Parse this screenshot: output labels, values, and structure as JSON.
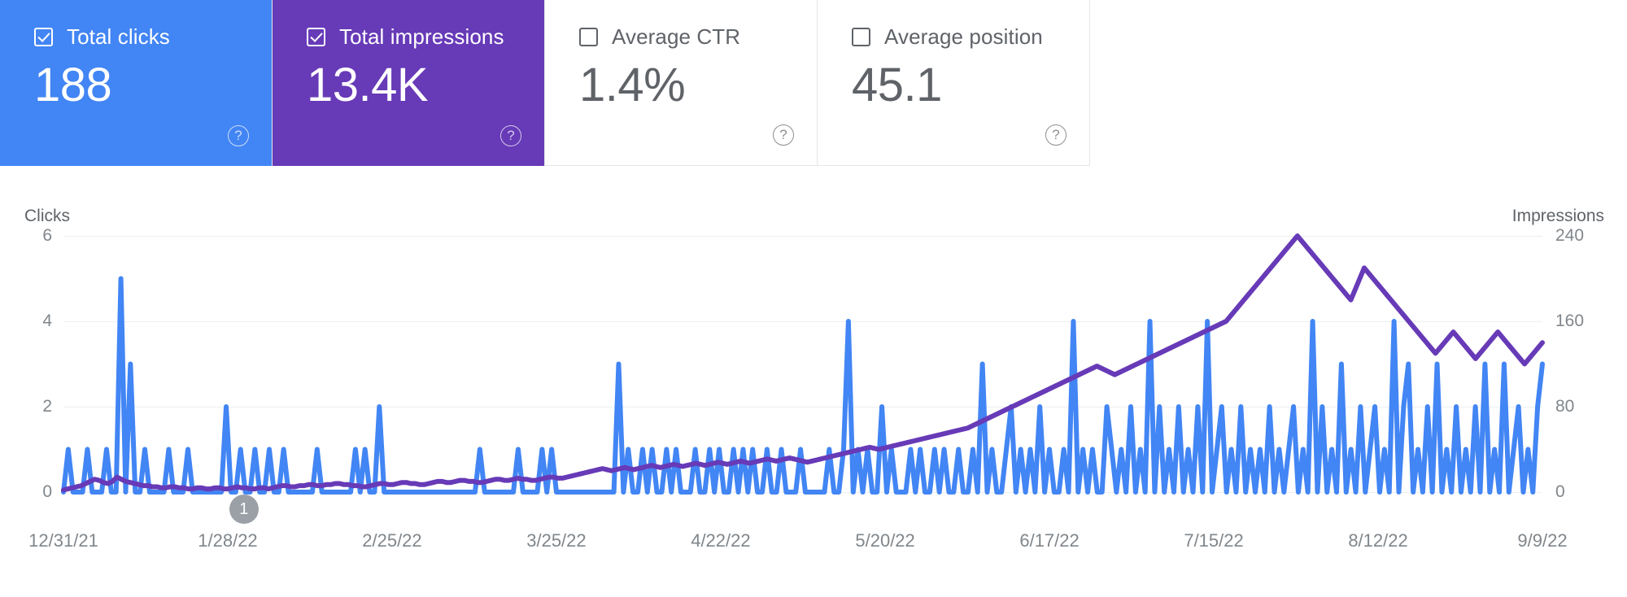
{
  "metric_cards": [
    {
      "id": "total-clicks",
      "label": "Total clicks",
      "value": "188",
      "checked": true,
      "selected": true,
      "bg": "#4285F4",
      "fg": "#ffffff",
      "help": "?"
    },
    {
      "id": "total-impressions",
      "label": "Total impressions",
      "value": "13.4K",
      "checked": true,
      "selected": true,
      "bg": "#673AB7",
      "fg": "#ffffff",
      "help": "?"
    },
    {
      "id": "average-ctr",
      "label": "Average CTR",
      "value": "1.4%",
      "checked": false,
      "selected": false,
      "bg": "#ffffff",
      "fg": "#5f6368",
      "help": "?"
    },
    {
      "id": "average-position",
      "label": "Average position",
      "value": "45.1",
      "checked": false,
      "selected": false,
      "bg": "#ffffff",
      "fg": "#5f6368",
      "help": "?"
    }
  ],
  "annotation": {
    "label": "1",
    "x_fraction": 0.122
  },
  "chart_data": {
    "type": "line",
    "title": "",
    "left_axis": {
      "label": "Clicks",
      "ticks": [
        0,
        2,
        4,
        6
      ],
      "min": 0,
      "max": 6,
      "color": "#4285F4"
    },
    "right_axis": {
      "label": "Impressions",
      "ticks": [
        0,
        80,
        160,
        240
      ],
      "min": 0,
      "max": 240,
      "color": "#673AB7"
    },
    "grid": true,
    "legend": "metric-cards",
    "xlabel": "",
    "x_tick_labels": [
      "12/31/21",
      "1/28/22",
      "2/25/22",
      "3/25/22",
      "4/22/22",
      "5/20/22",
      "6/17/22",
      "7/15/22",
      "8/12/22",
      "9/9/22"
    ],
    "x_tick_fractions": [
      0.0,
      0.1111,
      0.2222,
      0.3333,
      0.4444,
      0.5556,
      0.6667,
      0.7778,
      0.8889,
      1.0
    ],
    "x_start": "12/31/21",
    "x_end": "9/23/22",
    "series": [
      {
        "name": "Clicks",
        "axis": "left",
        "color": "#4285F4",
        "values": [
          0,
          1,
          0,
          0,
          0,
          1,
          0,
          0,
          0,
          1,
          0,
          0,
          5,
          0,
          3,
          0,
          0,
          1,
          0,
          0,
          0,
          0,
          1,
          0,
          0,
          0,
          1,
          0,
          0,
          0,
          0,
          0,
          0,
          0,
          2,
          0,
          0,
          1,
          0,
          0,
          1,
          0,
          0,
          1,
          0,
          0,
          1,
          0,
          0,
          0,
          0,
          0,
          0,
          1,
          0,
          0,
          0,
          0,
          0,
          0,
          0,
          1,
          0,
          1,
          0,
          0,
          2,
          0,
          0,
          0,
          0,
          0,
          0,
          0,
          0,
          0,
          0,
          0,
          0,
          0,
          0,
          0,
          0,
          0,
          0,
          0,
          0,
          1,
          0,
          0,
          0,
          0,
          0,
          0,
          0,
          1,
          0,
          0,
          0,
          0,
          1,
          0,
          1,
          0,
          0,
          0,
          0,
          0,
          0,
          0,
          0,
          0,
          0,
          0,
          0,
          0,
          3,
          0,
          1,
          0,
          0,
          1,
          0,
          1,
          0,
          0,
          1,
          0,
          1,
          0,
          0,
          0,
          1,
          0,
          0,
          1,
          0,
          1,
          0,
          0,
          1,
          0,
          1,
          0,
          1,
          0,
          0,
          1,
          0,
          0,
          1,
          0,
          0,
          0,
          1,
          0,
          0,
          0,
          0,
          0,
          1,
          0,
          0,
          1,
          4,
          0,
          1,
          0,
          1,
          0,
          0,
          2,
          0,
          1,
          0,
          0,
          0,
          1,
          0,
          1,
          0,
          0,
          1,
          0,
          1,
          0,
          0,
          1,
          0,
          0,
          1,
          0,
          3,
          0,
          1,
          0,
          0,
          1,
          2,
          0,
          1,
          0,
          1,
          0,
          2,
          0,
          1,
          0,
          0,
          1,
          0,
          4,
          0,
          1,
          0,
          1,
          0,
          0,
          2,
          1,
          0,
          1,
          0,
          2,
          0,
          1,
          0,
          4,
          0,
          2,
          0,
          1,
          0,
          2,
          0,
          1,
          0,
          2,
          0,
          4,
          0,
          1,
          2,
          0,
          1,
          0,
          2,
          0,
          1,
          0,
          1,
          0,
          2,
          0,
          1,
          0,
          1,
          2,
          0,
          1,
          0,
          4,
          0,
          2,
          0,
          1,
          0,
          3,
          0,
          1,
          0,
          2,
          0,
          1,
          2,
          0,
          1,
          0,
          4,
          0,
          2,
          3,
          0,
          1,
          0,
          2,
          0,
          3,
          0,
          1,
          0,
          2,
          0,
          1,
          0,
          2,
          0,
          3,
          0,
          1,
          0,
          3,
          0,
          1,
          2,
          0,
          1,
          0,
          2,
          3
        ]
      },
      {
        "name": "Impressions",
        "axis": "right",
        "color": "#673AB7",
        "values": [
          2,
          3,
          4,
          5,
          6,
          8,
          10,
          12,
          11,
          9,
          8,
          10,
          14,
          12,
          10,
          9,
          8,
          7,
          6,
          6,
          5,
          5,
          4,
          4,
          5,
          5,
          4,
          4,
          3,
          3,
          4,
          4,
          3,
          3,
          4,
          4,
          3,
          3,
          4,
          5,
          4,
          4,
          3,
          3,
          4,
          4,
          3,
          4,
          5,
          6,
          6,
          5,
          5,
          6,
          6,
          7,
          7,
          6,
          6,
          7,
          7,
          8,
          8,
          7,
          7,
          6,
          6,
          5,
          5,
          6,
          7,
          8,
          8,
          7,
          7,
          8,
          9,
          9,
          8,
          8,
          7,
          7,
          8,
          9,
          10,
          10,
          9,
          9,
          10,
          11,
          11,
          10,
          10,
          9,
          9,
          10,
          11,
          12,
          12,
          11,
          11,
          12,
          13,
          12,
          12,
          11,
          11,
          12,
          13,
          14,
          14,
          13,
          13,
          14,
          15,
          16,
          17,
          18,
          19,
          20,
          21,
          22,
          21,
          20,
          21,
          22,
          23,
          22,
          21,
          22,
          23,
          24,
          25,
          24,
          23,
          24,
          25,
          26,
          25,
          24,
          25,
          26,
          27,
          26,
          25,
          26,
          27,
          28,
          27,
          26,
          27,
          28,
          29,
          28,
          27,
          28,
          29,
          30,
          31,
          30,
          29,
          30,
          31,
          32,
          31,
          30,
          29,
          28,
          29,
          30,
          31,
          32,
          33,
          34,
          35,
          36,
          37,
          38,
          39,
          40,
          41,
          42,
          41,
          40,
          41,
          42,
          43,
          44,
          45,
          46,
          47,
          48,
          49,
          50,
          51,
          52,
          53,
          54,
          55,
          56,
          57,
          58,
          59,
          60,
          62,
          64,
          66,
          68,
          70,
          72,
          74,
          76,
          78,
          80,
          82,
          84,
          86,
          88,
          90,
          92,
          94,
          96,
          98,
          100,
          102,
          104,
          106,
          108,
          110,
          112,
          114,
          116,
          118,
          116,
          114,
          112,
          110,
          112,
          114,
          116,
          118,
          120,
          122,
          124,
          126,
          128,
          130,
          132,
          134,
          136,
          138,
          140,
          142,
          144,
          146,
          148,
          150,
          152,
          154,
          156,
          158,
          160,
          165,
          170,
          175,
          180,
          185,
          190,
          195,
          200,
          205,
          210,
          215,
          220,
          225,
          230,
          235,
          240,
          235,
          230,
          225,
          220,
          215,
          210,
          205,
          200,
          195,
          190,
          185,
          180,
          190,
          200,
          210,
          205,
          200,
          195,
          190,
          185,
          180,
          175,
          170,
          165,
          160,
          155,
          150,
          145,
          140,
          135,
          130,
          135,
          140,
          145,
          150,
          145,
          140,
          135,
          130,
          125,
          130,
          135,
          140,
          145,
          150,
          145,
          140,
          135,
          130,
          125,
          120,
          125,
          130,
          135,
          140
        ]
      }
    ]
  }
}
